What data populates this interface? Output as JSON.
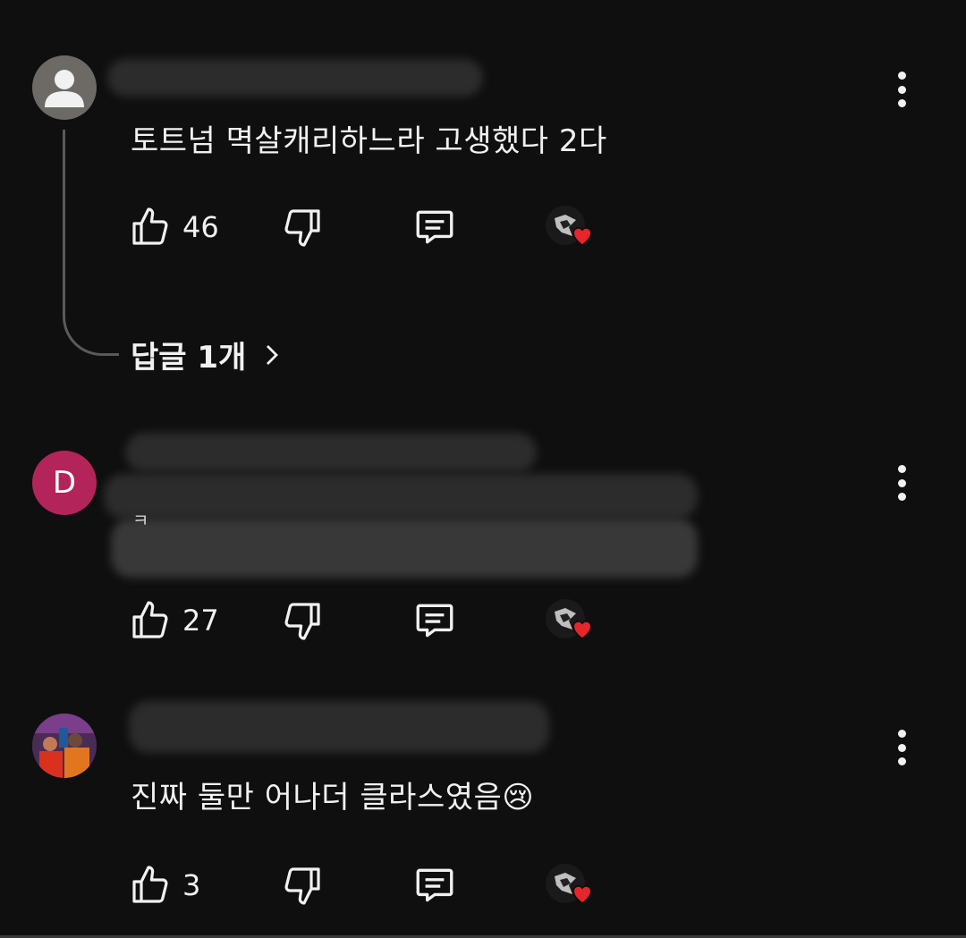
{
  "comments": [
    {
      "avatar_type": "default-user",
      "text": "토트넘 멱살캐리하느라 고생했다 2다",
      "likes": "46"
    },
    {
      "avatar_letter": "D",
      "avatar_color": "#b3245a",
      "text": "ㅋ",
      "likes": "27"
    },
    {
      "avatar_type": "photo",
      "text": "진짜 둘만 어나더 클라스였음",
      "emoji": "😢",
      "likes": "3"
    }
  ],
  "replies_label": "답글 1개",
  "replies_chevron": "chevron-right-icon",
  "colors": {
    "background": "#0f0f0f",
    "text": "#f1f1f1",
    "heart": "#e5262b",
    "thread_line": "#5a5a5a"
  },
  "icons": [
    "like-icon",
    "dislike-icon",
    "reply-icon",
    "creator-heart-icon",
    "more-vert-icon"
  ]
}
